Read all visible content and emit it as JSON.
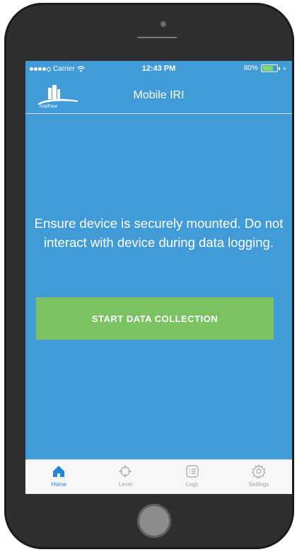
{
  "status_bar": {
    "carrier": "Carrier",
    "time": "12:43 PM",
    "battery": "80%",
    "battery_level": 0.8
  },
  "nav": {
    "logo_text": "TotalPave",
    "title": "Mobile IRI"
  },
  "main": {
    "message": "Ensure device is securely mounted. Do not interact with device during data logging.",
    "start_button_label": "START DATA COLLECTION"
  },
  "tabs": [
    {
      "label": "Home",
      "icon": "home-icon",
      "active": true
    },
    {
      "label": "Level",
      "icon": "crosshair-icon",
      "active": false
    },
    {
      "label": "Logs",
      "icon": "list-icon",
      "active": false
    },
    {
      "label": "Settings",
      "icon": "gear-icon",
      "active": false
    }
  ],
  "colors": {
    "screen_background": "#419bd7",
    "button_green": "#7cc162",
    "active_tab": "#1f88d6",
    "inactive_tab": "#a3a3a3"
  }
}
